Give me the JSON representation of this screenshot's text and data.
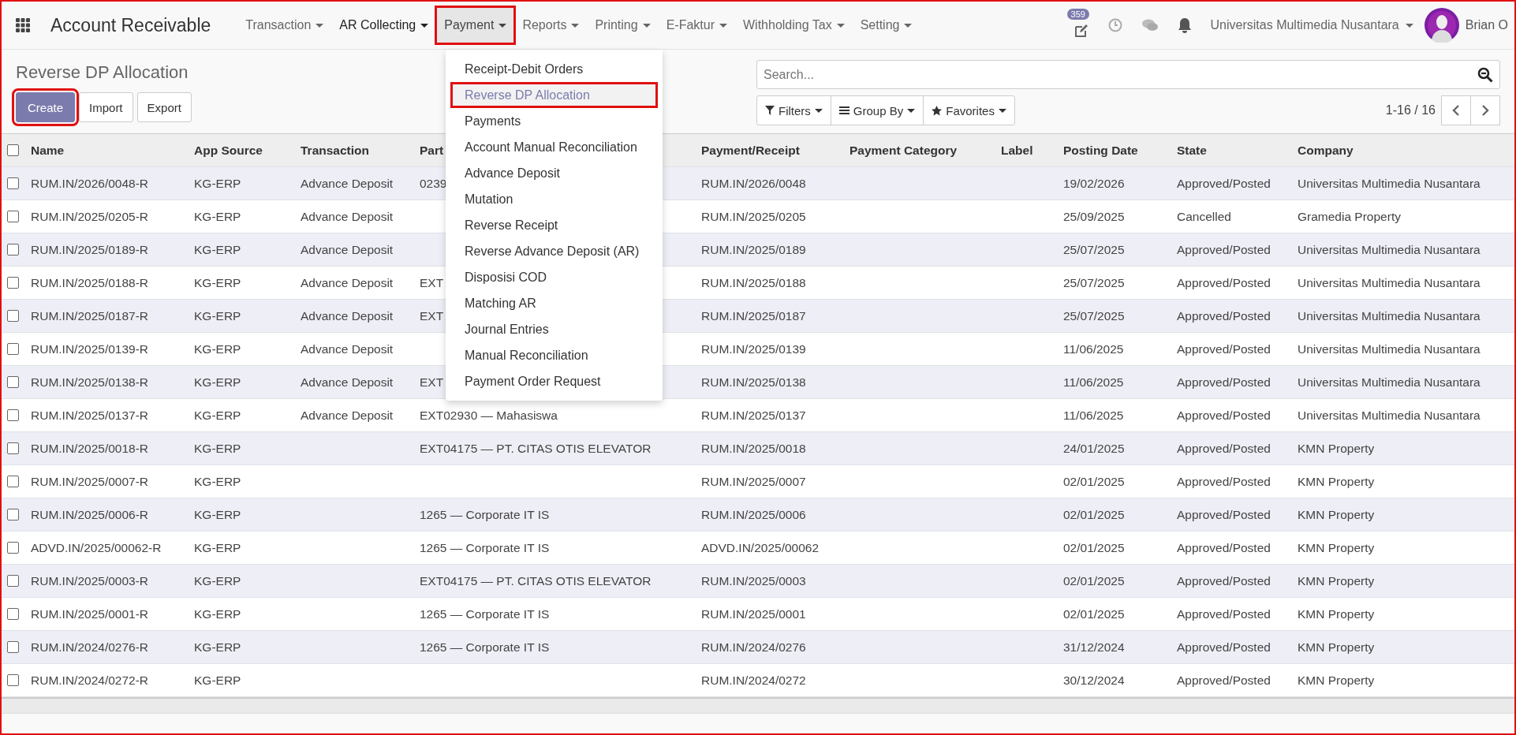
{
  "navbar": {
    "title": "Account Receivable",
    "menus": [
      {
        "label": "Transaction",
        "open": false,
        "highlighted": false,
        "strong": false
      },
      {
        "label": "AR Collecting",
        "open": false,
        "highlighted": false,
        "strong": true
      },
      {
        "label": "Payment",
        "open": true,
        "highlighted": true,
        "strong": false,
        "items": [
          {
            "label": "Receipt-Debit Orders",
            "selected": false,
            "highlighted": false
          },
          {
            "label": "Reverse DP Allocation",
            "selected": true,
            "highlighted": true
          },
          {
            "label": "Payments",
            "selected": false,
            "highlighted": false
          },
          {
            "label": "Account Manual Reconciliation",
            "selected": false,
            "highlighted": false
          },
          {
            "label": "Advance Deposit",
            "selected": false,
            "highlighted": false
          },
          {
            "label": "Mutation",
            "selected": false,
            "highlighted": false
          },
          {
            "label": "Reverse Receipt",
            "selected": false,
            "highlighted": false
          },
          {
            "label": "Reverse Advance Deposit (AR)",
            "selected": false,
            "highlighted": false
          },
          {
            "label": "Disposisi COD",
            "selected": false,
            "highlighted": false
          },
          {
            "label": "Matching AR",
            "selected": false,
            "highlighted": false
          },
          {
            "label": "Journal Entries",
            "selected": false,
            "highlighted": false
          },
          {
            "label": "Manual Reconciliation",
            "selected": false,
            "highlighted": false
          },
          {
            "label": "Payment Order Request",
            "selected": false,
            "highlighted": false
          }
        ]
      },
      {
        "label": "Reports",
        "open": false,
        "highlighted": false,
        "strong": false
      },
      {
        "label": "Printing",
        "open": false,
        "highlighted": false,
        "strong": false
      },
      {
        "label": "E-Faktur",
        "open": false,
        "highlighted": false,
        "strong": false
      },
      {
        "label": "Withholding Tax",
        "open": false,
        "highlighted": false,
        "strong": false
      },
      {
        "label": "Setting",
        "open": false,
        "highlighted": false,
        "strong": false
      }
    ],
    "activity_badge": "359",
    "company": "Universitas Multimedia Nusantara",
    "user": "Brian O"
  },
  "control_panel": {
    "title": "Reverse DP Allocation",
    "buttons": [
      {
        "label": "Create",
        "kind": "primary",
        "highlighted": true
      },
      {
        "label": "Import",
        "kind": "secondary",
        "highlighted": false
      },
      {
        "label": "Export",
        "kind": "secondary",
        "highlighted": false
      }
    ],
    "search": {
      "placeholder": "Search..."
    },
    "filters": [
      {
        "label": "Filters",
        "kind": "filter"
      },
      {
        "label": "Group By",
        "kind": "group"
      },
      {
        "label": "Favorites",
        "kind": "favorite"
      }
    ],
    "pager": "1-16 / 16"
  },
  "table": {
    "select_all_checked": false,
    "columns": [
      "Name",
      "App Source",
      "Transaction",
      "Part",
      "Payment/Receipt",
      "Payment Category",
      "Label",
      "Posting Date",
      "State",
      "Company"
    ],
    "rows": [
      {
        "checked": false,
        "name": "RUM.IN/2026/0048-R",
        "app_source": "KG-ERP",
        "transaction": "Advance Deposit",
        "partner": "0239",
        "payment_receipt": "RUM.IN/2026/0048",
        "posting_date": "19/02/2026",
        "state": "Approved/Posted",
        "company": "Universitas Multimedia Nusantara"
      },
      {
        "checked": false,
        "name": "RUM.IN/2025/0205-R",
        "app_source": "KG-ERP",
        "transaction": "Advance Deposit",
        "payment_receipt": "RUM.IN/2025/0205",
        "posting_date": "25/09/2025",
        "state": "Cancelled",
        "company": "Gramedia Property"
      },
      {
        "checked": false,
        "name": "RUM.IN/2025/0189-R",
        "app_source": "KG-ERP",
        "transaction": "Advance Deposit",
        "payment_receipt": "RUM.IN/2025/0189",
        "posting_date": "25/07/2025",
        "state": "Approved/Posted",
        "company": "Universitas Multimedia Nusantara"
      },
      {
        "checked": false,
        "name": "RUM.IN/2025/0188-R",
        "app_source": "KG-ERP",
        "transaction": "Advance Deposit",
        "partner": "EXT",
        "payment_receipt": "RUM.IN/2025/0188",
        "posting_date": "25/07/2025",
        "state": "Approved/Posted",
        "company": "Universitas Multimedia Nusantara"
      },
      {
        "checked": false,
        "name": "RUM.IN/2025/0187-R",
        "app_source": "KG-ERP",
        "transaction": "Advance Deposit",
        "partner": "EXT",
        "payment_receipt": "RUM.IN/2025/0187",
        "posting_date": "25/07/2025",
        "state": "Approved/Posted",
        "company": "Universitas Multimedia Nusantara"
      },
      {
        "checked": false,
        "name": "RUM.IN/2025/0139-R",
        "app_source": "KG-ERP",
        "transaction": "Advance Deposit",
        "payment_receipt": "RUM.IN/2025/0139",
        "posting_date": "11/06/2025",
        "state": "Approved/Posted",
        "company": "Universitas Multimedia Nusantara"
      },
      {
        "checked": false,
        "name": "RUM.IN/2025/0138-R",
        "app_source": "KG-ERP",
        "transaction": "Advance Deposit",
        "partner": "EXT",
        "payment_receipt": "RUM.IN/2025/0138",
        "posting_date": "11/06/2025",
        "state": "Approved/Posted",
        "company": "Universitas Multimedia Nusantara"
      },
      {
        "checked": false,
        "name": "RUM.IN/2025/0137-R",
        "app_source": "KG-ERP",
        "transaction": "Advance Deposit",
        "partner": "EXT02930 — Mahasiswa",
        "payment_receipt": "RUM.IN/2025/0137",
        "posting_date": "11/06/2025",
        "state": "Approved/Posted",
        "company": "Universitas Multimedia Nusantara"
      },
      {
        "checked": false,
        "name": "RUM.IN/2025/0018-R",
        "app_source": "KG-ERP",
        "partner": "EXT04175 — PT. CITAS OTIS ELEVATOR",
        "payment_receipt": "RUM.IN/2025/0018",
        "posting_date": "24/01/2025",
        "state": "Approved/Posted",
        "company": "KMN Property"
      },
      {
        "checked": false,
        "name": "RUM.IN/2025/0007-R",
        "app_source": "KG-ERP",
        "payment_receipt": "RUM.IN/2025/0007",
        "posting_date": "02/01/2025",
        "state": "Approved/Posted",
        "company": "KMN Property"
      },
      {
        "checked": false,
        "name": "RUM.IN/2025/0006-R",
        "app_source": "KG-ERP",
        "partner": "1265 — Corporate IT IS",
        "payment_receipt": "RUM.IN/2025/0006",
        "posting_date": "02/01/2025",
        "state": "Approved/Posted",
        "company": "KMN Property"
      },
      {
        "checked": false,
        "name": "ADVD.IN/2025/00062-R",
        "app_source": "KG-ERP",
        "partner": "1265 — Corporate IT IS",
        "payment_receipt": "ADVD.IN/2025/00062",
        "posting_date": "02/01/2025",
        "state": "Approved/Posted",
        "company": "KMN Property"
      },
      {
        "checked": false,
        "name": "RUM.IN/2025/0003-R",
        "app_source": "KG-ERP",
        "partner": "EXT04175 — PT. CITAS OTIS ELEVATOR",
        "payment_receipt": "RUM.IN/2025/0003",
        "posting_date": "02/01/2025",
        "state": "Approved/Posted",
        "company": "KMN Property"
      },
      {
        "checked": false,
        "name": "RUM.IN/2025/0001-R",
        "app_source": "KG-ERP",
        "partner": "1265 — Corporate IT IS",
        "payment_receipt": "RUM.IN/2025/0001",
        "posting_date": "02/01/2025",
        "state": "Approved/Posted",
        "company": "KMN Property"
      },
      {
        "checked": false,
        "name": "RUM.IN/2024/0276-R",
        "app_source": "KG-ERP",
        "partner": "1265 — Corporate IT IS",
        "payment_receipt": "RUM.IN/2024/0276",
        "posting_date": "31/12/2024",
        "state": "Approved/Posted",
        "company": "KMN Property"
      },
      {
        "checked": false,
        "name": "RUM.IN/2024/0272-R",
        "app_source": "KG-ERP",
        "payment_receipt": "RUM.IN/2024/0272",
        "posting_date": "30/12/2024",
        "state": "Approved/Posted",
        "company": "KMN Property"
      }
    ]
  }
}
